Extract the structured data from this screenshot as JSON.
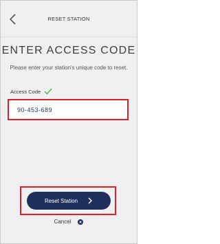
{
  "header": {
    "title": "RESET STATION",
    "back_icon": "chevron-left-icon"
  },
  "main": {
    "heading": "ENTER ACCESS CODE",
    "subtitle": "Please enter your station's unique code to reset.",
    "field": {
      "label": "Access Code",
      "value": "90-453-689",
      "status_icon": "check-icon"
    }
  },
  "actions": {
    "primary_label": "Reset Station",
    "primary_icon": "chevron-right-icon",
    "cancel_label": "Cancel",
    "cancel_icon": "close-circle-icon"
  },
  "colors": {
    "primary": "#1f2f5c",
    "highlight": "#d71f2a",
    "success": "#5cb85c"
  }
}
